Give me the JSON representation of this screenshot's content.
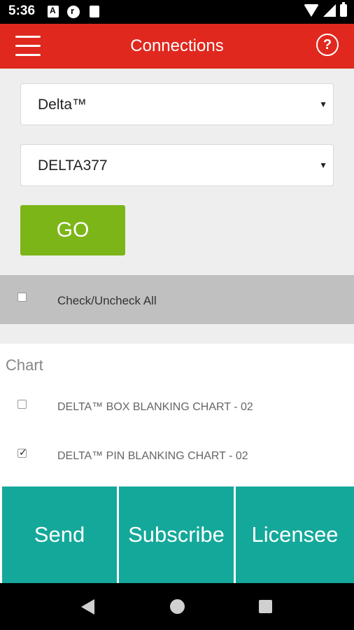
{
  "status_bar": {
    "time": "5:36",
    "icons": [
      "a-notification-icon",
      "r-notification-icon",
      "sd-card-icon",
      "wifi-icon",
      "signal-icon",
      "battery-icon"
    ]
  },
  "app_bar": {
    "title": "Connections",
    "menu_icon": "hamburger-menu-icon",
    "help_label": "?",
    "background": "#e0281e"
  },
  "filters": {
    "brand_select": "Delta™",
    "model_select": "DELTA377",
    "go_label": "GO"
  },
  "check_all": {
    "label": "Check/Uncheck All",
    "checked": false
  },
  "chart_list": {
    "heading": "Chart",
    "items": [
      {
        "label": "DELTA™ BOX BLANKING CHART - 02",
        "checked": false
      },
      {
        "label": "DELTA™ PIN BLANKING CHART - 02",
        "checked": true
      }
    ]
  },
  "actions": {
    "send": "Send",
    "subscribe": "Subscribe",
    "licensee": "Licensee",
    "color": "#14a89a"
  },
  "colors": {
    "go_button": "#7cb518",
    "check_all_bar": "#c0c0c0"
  }
}
